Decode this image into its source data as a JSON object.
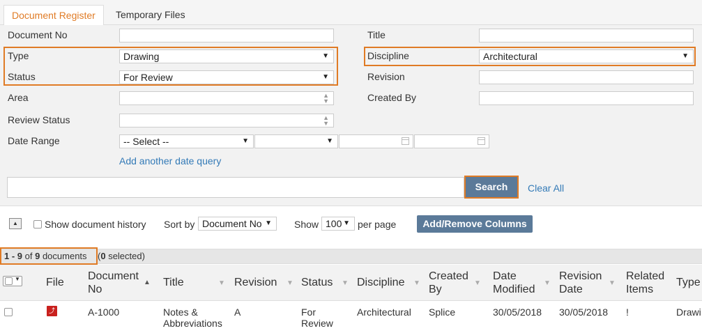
{
  "tabs": [
    {
      "label": "Document Register"
    },
    {
      "label": "Temporary Files"
    }
  ],
  "filters": {
    "document_no": {
      "label": "Document No",
      "value": ""
    },
    "title": {
      "label": "Title",
      "value": ""
    },
    "type": {
      "label": "Type",
      "value": "Drawing"
    },
    "discipline": {
      "label": "Discipline",
      "value": "Architectural"
    },
    "status": {
      "label": "Status",
      "value": "For Review"
    },
    "revision": {
      "label": "Revision",
      "value": ""
    },
    "area": {
      "label": "Area",
      "value": ""
    },
    "created_by": {
      "label": "Created By",
      "value": ""
    },
    "review_status": {
      "label": "Review Status",
      "value": ""
    },
    "date_range": {
      "label": "Date Range",
      "select_value": "-- Select --",
      "second_value": "",
      "from": "",
      "to": ""
    },
    "add_date_query": "Add another date query"
  },
  "search": {
    "value": "",
    "button_label": "Search",
    "clear_label": "Clear All"
  },
  "toolbar": {
    "show_history_label": "Show document history",
    "sort_by_label": "Sort by",
    "sort_by_value": "Document No",
    "show_label": "Show",
    "show_value": "100",
    "per_page_label": "per page",
    "add_remove_columns": "Add/Remove Columns"
  },
  "results": {
    "range_start": "1",
    "range_sep": " - ",
    "range_end": "9",
    "of": " of ",
    "total": "9",
    "documents": " documents",
    "selected_open": " (",
    "selected_count": "0",
    "selected_close": " selected)"
  },
  "table": {
    "columns": {
      "file": "File",
      "document_no_1": "Document",
      "document_no_2": "No",
      "title": "Title",
      "revision": "Revision",
      "status": "Status",
      "discipline": "Discipline",
      "created_by_1": "Created",
      "created_by_2": "By",
      "date_modified_1": "Date",
      "date_modified_2": "Modified",
      "revision_date_1": "Revision",
      "revision_date_2": "Date",
      "related_1": "Related",
      "related_2": "Items",
      "type": "Type"
    },
    "rows": [
      {
        "file_icon": "pdf-icon",
        "document_no": "A-1000",
        "title_1": "Notes &",
        "title_2": "Abbreviations",
        "revision": "A",
        "status_1": "For",
        "status_2": "Review",
        "discipline": "Architectural",
        "created_by": "Splice",
        "date_modified": "30/05/2018",
        "revision_date": "30/05/2018",
        "related": "!",
        "type": "Drawi"
      }
    ]
  },
  "colors": {
    "accent": "#e07b25",
    "button": "#5b7a99",
    "link": "#337ab7",
    "pdf": "#c9211e"
  }
}
